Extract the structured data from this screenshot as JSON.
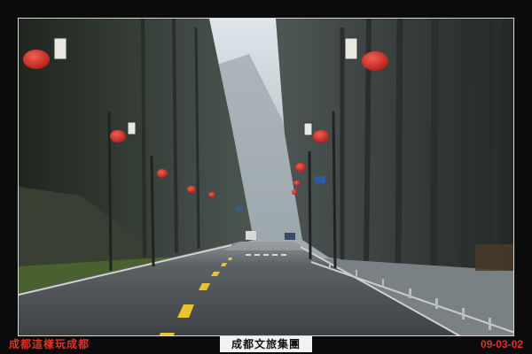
{
  "captions": {
    "left": "成都這樣玩成都",
    "center": "成都文旅集團",
    "right": "09-03-02"
  },
  "colors": {
    "frame": "#0b0b0b",
    "accent_red": "#e0302a",
    "lantern_red": "#d42a22",
    "road": "#4a4d50",
    "lane_yellow": "#e8c230",
    "mist": "#b9c2c7"
  }
}
